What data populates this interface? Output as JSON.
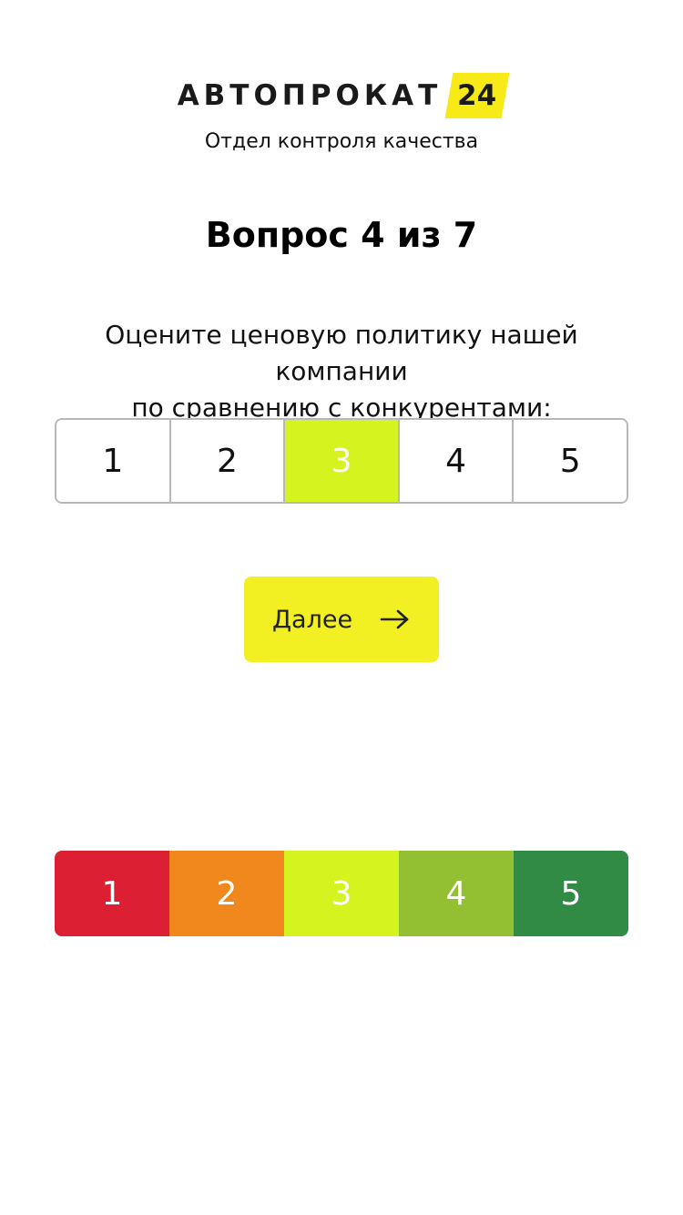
{
  "logo": {
    "word": "АВТОПРОКАТ",
    "badge": "24",
    "badge_color": "#f7ea17"
  },
  "subtitle": "Отдел контроля качества",
  "question": {
    "title": "Вопрос 4 из 7",
    "text_line1": "Оцените ценовую политику нашей компании",
    "text_line2": "по сравнению с конкурентами:"
  },
  "rating": {
    "options": [
      "1",
      "2",
      "3",
      "4",
      "5"
    ],
    "selected": "3",
    "selected_color": "#d4f31f"
  },
  "next_button": {
    "label": "Далее",
    "icon": "arrow-right-icon",
    "color": "#f2f022"
  },
  "legend": {
    "items": [
      {
        "label": "1",
        "color": "#dc1f33"
      },
      {
        "label": "2",
        "color": "#f0881d"
      },
      {
        "label": "3",
        "color": "#d4f31f"
      },
      {
        "label": "4",
        "color": "#93bf33"
      },
      {
        "label": "5",
        "color": "#328b45"
      }
    ]
  }
}
